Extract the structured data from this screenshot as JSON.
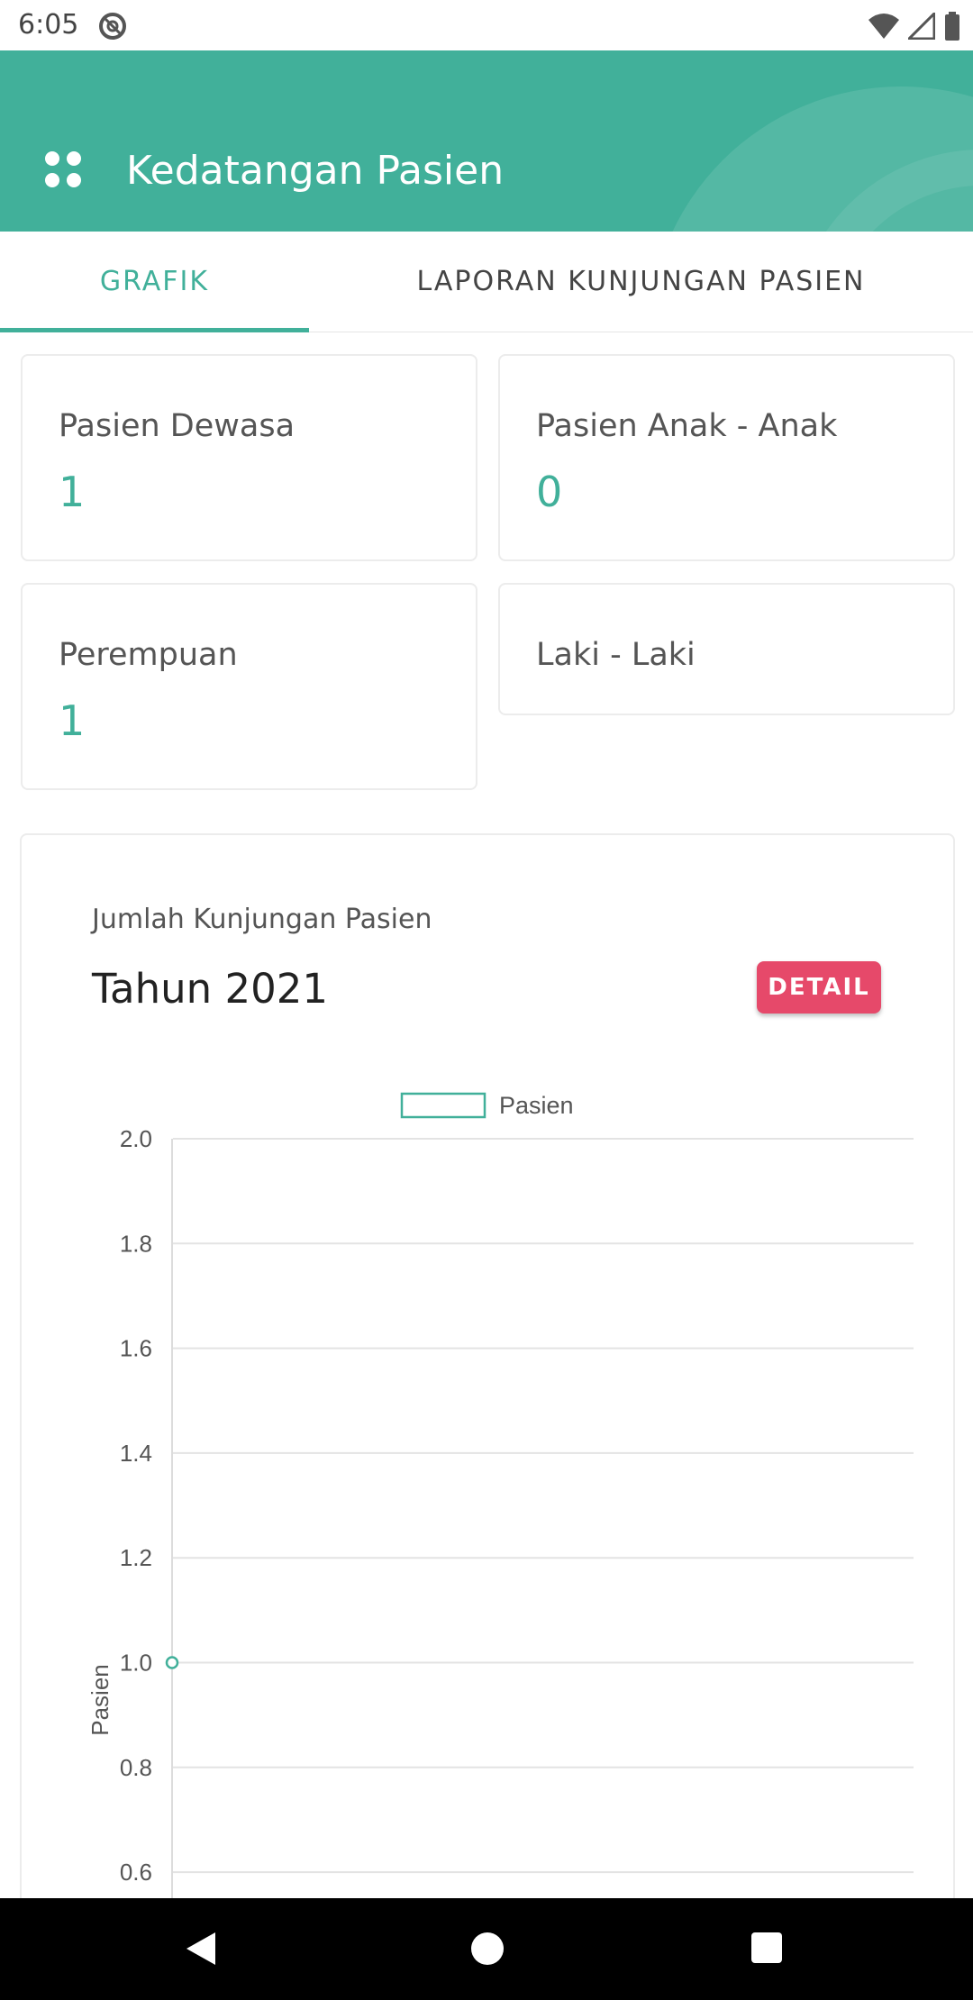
{
  "status_bar": {
    "time": "6:05"
  },
  "app_bar": {
    "title": "Kedatangan Pasien",
    "color": "#41b09a"
  },
  "tabs": [
    {
      "label": "GRAFIK",
      "active": true
    },
    {
      "label": "LAPORAN KUNJUNGAN PASIEN",
      "active": false
    }
  ],
  "stats": {
    "dewasa": {
      "label": "Pasien Dewasa",
      "value": "1"
    },
    "anak": {
      "label": "Pasien Anak - Anak",
      "value": "0"
    },
    "perempuan": {
      "label": "Perempuan",
      "value": "1"
    },
    "laki": {
      "label": "Laki - Laki",
      "value": ""
    }
  },
  "chart_section": {
    "subtitle": "Jumlah Kunjungan Pasien",
    "title": "Tahun 2021",
    "detail_label": "DETAIL",
    "detail_color": "#e6496a"
  },
  "chart_data": {
    "type": "line",
    "series": [
      {
        "name": "Pasien",
        "color": "#41b09a",
        "values": [
          1
        ]
      }
    ],
    "ylabel": "Pasien",
    "yticks": [
      "2.0",
      "1.8",
      "1.6",
      "1.4",
      "1.2",
      "1.0",
      "0.8",
      "0.6"
    ],
    "ylim": [
      0.6,
      2.0
    ],
    "grid": true,
    "legend": "top"
  }
}
